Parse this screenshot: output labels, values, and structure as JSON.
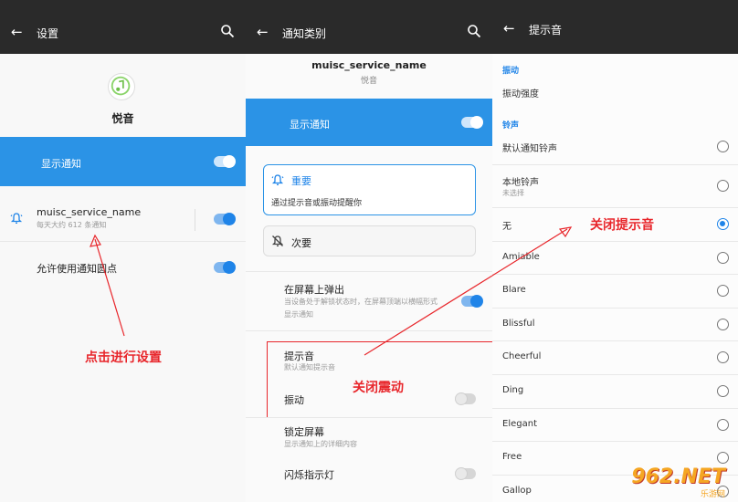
{
  "panel1": {
    "title": "设置",
    "back_icon": "back-arrow-icon",
    "search_icon": "search-icon",
    "app_name": "悦音",
    "show_notification": "显示通知",
    "channel_name": "muisc_service_name",
    "channel_sub": "每天大约 612 条通知",
    "allow_dot": "允许使用通知圆点",
    "annotation": "点击进行设置"
  },
  "panel2": {
    "title": "通知类别",
    "header_name": "muisc_service_name",
    "header_sub": "悦音",
    "show_notification": "显示通知",
    "important_title": "重要",
    "important_desc": "通过提示音或振动提醒你",
    "silent_title": "次要",
    "popup_title": "在屏幕上弹出",
    "popup_desc": "当设备处于解锁状态时，在屏幕顶端以横幅形式显示通知",
    "sound_title": "提示音",
    "sound_sub": "默认通知提示音",
    "vibrate_title": "振动",
    "lock_title": "锁定屏幕",
    "lock_sub": "显示通知上的详细内容",
    "blink_title": "闪烁指示灯",
    "annotation": "关闭震动"
  },
  "panel3": {
    "title": "提示音",
    "section_vibrate": "振动",
    "vibrate_strength": "振动强度",
    "section_ringtone": "铃声",
    "default_ringtone": "默认通知铃声",
    "local_ringtone": "本地铃声",
    "local_ringtone_sub": "未选择",
    "tones": [
      "无",
      "Amiable",
      "Blare",
      "Blissful",
      "Cheerful",
      "Ding",
      "Elegant",
      "Free",
      "Gallop"
    ],
    "selected_tone": "无",
    "annotation": "关闭提示音"
  },
  "watermark": "962.NET",
  "watermark_sub": "乐游网",
  "colors": {
    "accent": "#2b93e6",
    "topbar": "#2a2a2a",
    "annotation_red": "#e8262b"
  }
}
